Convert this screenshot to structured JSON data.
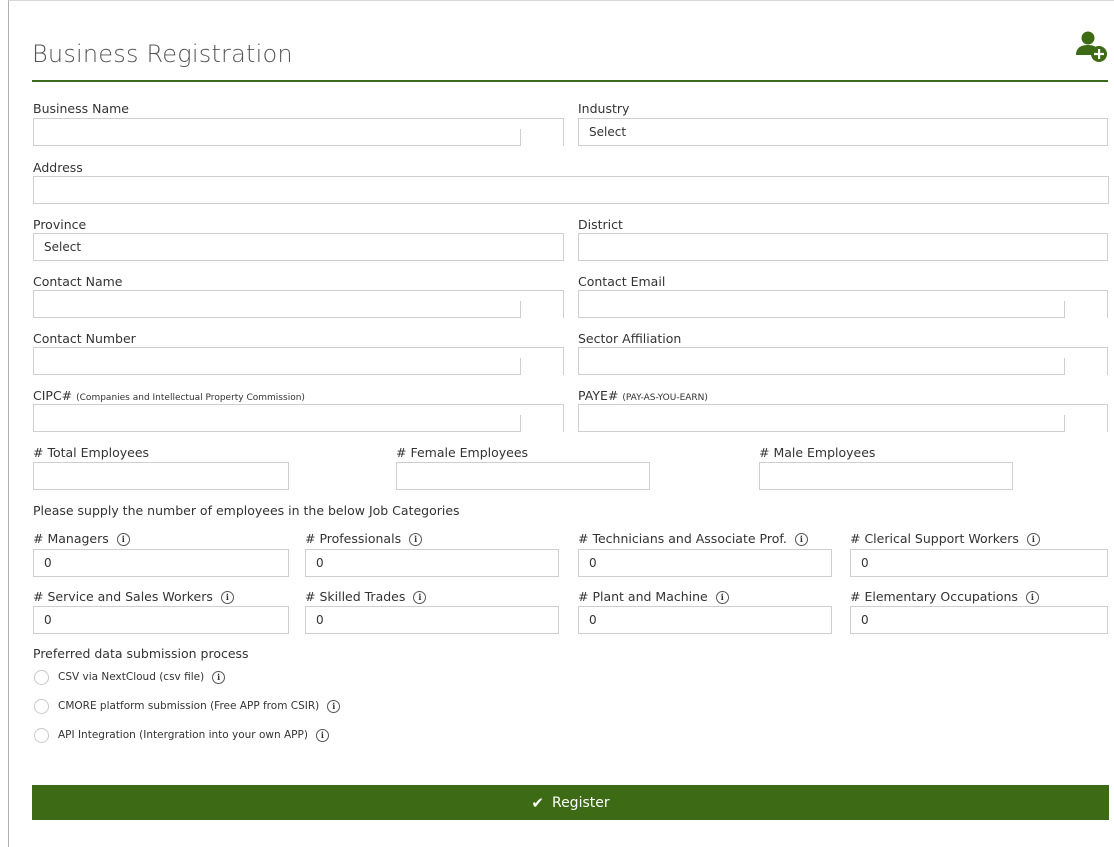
{
  "title": "Business Registration",
  "accent_color": "#3d6a14",
  "header_icon": "add-user-icon",
  "fields": {
    "business_name": {
      "label": "Business Name",
      "value": ""
    },
    "industry": {
      "label": "Industry",
      "value": "Select"
    },
    "address": {
      "label": "Address",
      "value": ""
    },
    "province": {
      "label": "Province",
      "value": "Select"
    },
    "district": {
      "label": "District",
      "value": ""
    },
    "contact_name": {
      "label": "Contact Name",
      "value": ""
    },
    "contact_email": {
      "label": "Contact Email",
      "value": ""
    },
    "contact_number": {
      "label": "Contact Number",
      "value": ""
    },
    "sector_affiliation": {
      "label": "Sector Affiliation",
      "value": ""
    },
    "cipc": {
      "label": "CIPC#",
      "note": "(Companies and Intellectual Property Commission)",
      "value": ""
    },
    "paye": {
      "label": "PAYE#",
      "note": "(PAY-AS-YOU-EARN)",
      "value": ""
    },
    "total_employees": {
      "label": "# Total Employees",
      "value": ""
    },
    "female_employees": {
      "label": "# Female Employees",
      "value": ""
    },
    "male_employees": {
      "label": "# Male Employees",
      "value": ""
    }
  },
  "job_categories_prompt": "Please supply the number of employees in the below Job Categories",
  "job_categories": [
    {
      "label": "# Managers",
      "value": "0"
    },
    {
      "label": "# Professionals",
      "value": "0"
    },
    {
      "label": "# Technicians and Associate Prof.",
      "value": "0"
    },
    {
      "label": "# Clerical Support Workers",
      "value": "0"
    },
    {
      "label": "# Service and Sales Workers",
      "value": "0"
    },
    {
      "label": "# Skilled Trades",
      "value": "0"
    },
    {
      "label": "# Plant and Machine",
      "value": "0"
    },
    {
      "label": "# Elementary Occupations",
      "value": "0"
    }
  ],
  "submission": {
    "label": "Preferred data submission process",
    "options": [
      {
        "label": "CSV via NextCloud (csv file)",
        "selected": false
      },
      {
        "label": "CMORE platform submission (Free APP from CSIR)",
        "selected": false
      },
      {
        "label": "API Integration (Intergration into your own APP)",
        "selected": false
      }
    ]
  },
  "register_label": "Register",
  "info_glyph": "i"
}
